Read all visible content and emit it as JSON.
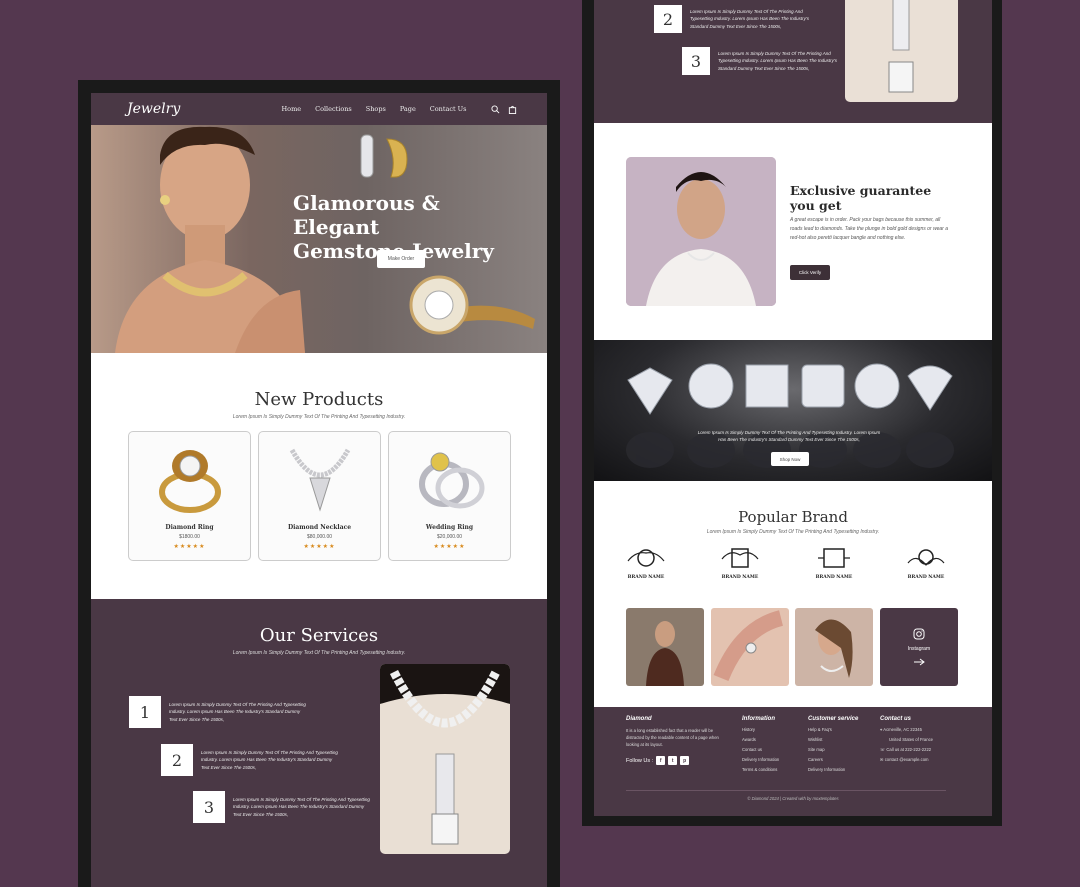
{
  "left": {
    "nav": {
      "logo": "Jewelry",
      "links": [
        "Home",
        "Collections",
        "Shops",
        "Page",
        "Contact Us"
      ],
      "icons": [
        "search-icon",
        "bag-icon"
      ]
    },
    "hero": {
      "title_line1": "Glamorous & Elegant",
      "title_line2": "Gemstone Jewelry",
      "button": "Make Order"
    },
    "new_products": {
      "title": "New Products",
      "subtitle": "Lorem Ipsum Is Simply Dummy Text Of The Printing And Typesetting Industry.",
      "items": [
        {
          "name": "Diamond Ring",
          "price": "$1800.00",
          "stars": "★★★★★"
        },
        {
          "name": "Diamond Necklace",
          "price": "$80,000.00",
          "stars": "★★★★★"
        },
        {
          "name": "Wedding Ring",
          "price": "$20,000.00",
          "stars": "★★★★★"
        }
      ]
    },
    "services": {
      "title": "Our Services",
      "subtitle": "Lorem Ipsum Is Simply Dummy Text Of The Printing And Typesetting Industry.",
      "steps": [
        {
          "num": "1",
          "text": "Lorem Ipsum Is Simply Dummy Text Of The Printing And Typesetting Industry. Lorem Ipsum Has Been The Industry's Standard Dummy Text Ever Since The 1500s,"
        },
        {
          "num": "2",
          "text": "Lorem Ipsum Is Simply Dummy Text Of The Printing And Typesetting Industry. Lorem Ipsum Has Been The Industry's Standard Dummy Text Ever Since The 1500s,"
        },
        {
          "num": "3",
          "text": "Lorem Ipsum Is Simply Dummy Text Of The Printing And Typesetting Industry. Lorem Ipsum Has Been The Industry's Standard Dummy Text Ever Since The 1500s,"
        }
      ]
    }
  },
  "right": {
    "steps_top": [
      {
        "num": "2",
        "text": "Lorem Ipsum Is Simply Dummy Text Of The Printing And Typesetting Industry. Lorem Ipsum Has Been The Industry's Standard Dummy Text Ever Since The 1500s,"
      },
      {
        "num": "3",
        "text": "Lorem Ipsum Is Simply Dummy Text Of The Printing And Typesetting Industry. Lorem Ipsum Has Been The Industry's Standard Dummy Text Ever Since The 1500s,"
      }
    ],
    "guarantee": {
      "title_line1": "Exclusive guarantee",
      "title_line2": "you get",
      "text": "A great escape is in order. Pack your bags because this summer, all roads lead to diamonds. Take the plunge in bold gold designs or wear a red-hot also peretti lacquer bangle and nothing else.",
      "button": "Click Verify"
    },
    "diamonds": {
      "text": "Lorem Ipsum Is Simply Dummy Text Of The Printing And Typesetting Industry. Lorem Ipsum Has Been The Industry's Standard Dummy Text Ever Since The 1500s,",
      "button": "Shop Now"
    },
    "brands": {
      "title": "Popular Brand",
      "subtitle": "Lorem Ipsum Is Simply Dummy Text Of The Printing And Typesetting Industry.",
      "logo_text": "BRAND NAME",
      "instagram_label": "Instagram"
    },
    "footer": {
      "brand": "Diamond",
      "about": "It is a long established fact that a reader will be distracted by the readable content of a page when looking at its layout.",
      "follow": "Follow Us :",
      "info_title": "Information",
      "info_items": [
        "History",
        "Awards",
        "Contact us",
        "Delivery Information",
        "Terms & conditions"
      ],
      "cs_title": "Customer service",
      "cs_items": [
        "Help & Faq's",
        "Wishlist",
        "Site map",
        "Careers",
        "Delivery Information"
      ],
      "contact_title": "Contact us",
      "address1": "Acmeville, AC 22345",
      "address2": "United States of France",
      "phone": "Call us at 222-222-2222",
      "email": "contact @example.com",
      "copyright": "© Diamond 2024 | Created with by moxtemplates"
    }
  }
}
